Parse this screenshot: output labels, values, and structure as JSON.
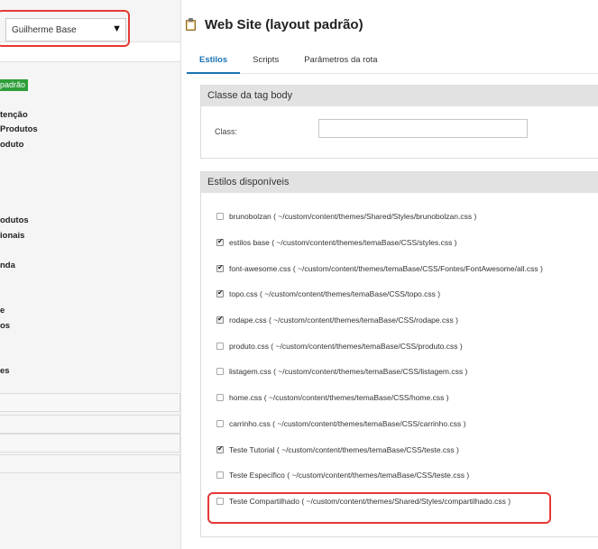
{
  "sidebar": {
    "theme_select": {
      "value": "Guilherme Base",
      "caret": "▼"
    },
    "badge": "padrão",
    "nav_items": [
      "tenção",
      "Produtos",
      "oduto",
      "odutos",
      "ionais",
      "nda",
      "e",
      "os",
      "es"
    ]
  },
  "header": {
    "icon": "clipboard-icon",
    "title": "Web Site (layout padrão)"
  },
  "tabs": [
    "Estilos",
    "Scripts",
    "Parâmetros da rota"
  ],
  "body_panel": {
    "title": "Classe da tag body",
    "class_label": "Class:",
    "class_value": ""
  },
  "styles_panel": {
    "title": "Estilos disponíveis",
    "items": [
      {
        "label": "brunobolzan ( ~/custom/content/themes/Shared/Styles/brunobolzan.css )",
        "checked": false
      },
      {
        "label": "estilos base ( ~/custom/content/themes/temaBase/CSS/styles.css )",
        "checked": true
      },
      {
        "label": "font-awesome.css ( ~/custom/content/themes/temaBase/CSS/Fontes/FontAwesome/all.css )",
        "checked": true
      },
      {
        "label": "topo.css ( ~/custom/content/themes/temaBase/CSS/topo.css )",
        "checked": true
      },
      {
        "label": "rodape.css ( ~/custom/content/themes/temaBase/CSS/rodape.css )",
        "checked": true
      },
      {
        "label": "produto.css ( ~/custom/content/themes/temaBase/CSS/produto.css )",
        "checked": false
      },
      {
        "label": "listagem.css ( ~/custom/content/themes/temaBase/CSS/listagem.css )",
        "checked": false
      },
      {
        "label": "home.css ( ~/custom/content/themes/temaBase/CSS/home.css )",
        "checked": false
      },
      {
        "label": "carrinho.css ( ~/custom/content/themes/temaBase/CSS/carrinho.css )",
        "checked": false
      },
      {
        "label": "Teste Tutorial ( ~/custom/content/themes/temaBase/CSS/teste.css )",
        "checked": true
      },
      {
        "label": "Teste Específico ( ~/custom/content/themes/temaBase/CSS/teste.css )",
        "checked": false
      },
      {
        "label": "Teste Compartilhado ( ~/custom/content/themes/Shared/Styles/compartilhado.css )",
        "checked": false
      }
    ]
  },
  "colors": {
    "accent": "#1a73b5",
    "highlight": "#e53935",
    "badge": "#2e9e3a"
  }
}
